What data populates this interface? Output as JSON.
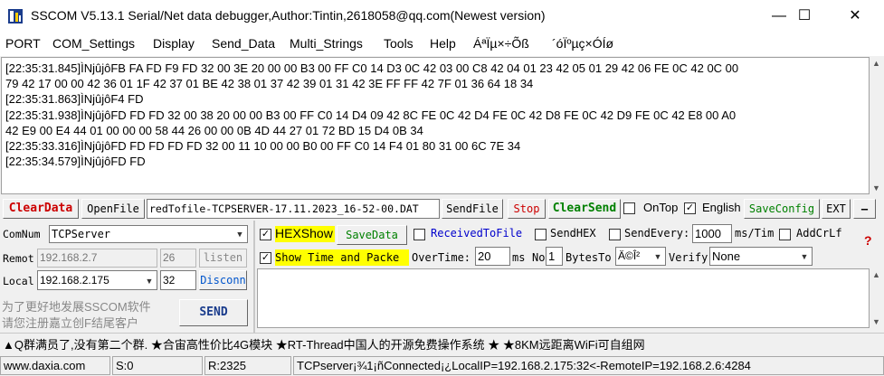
{
  "titlebar": {
    "title": "SSCOM V5.13.1 Serial/Net data debugger,Author:Tintin,2618058@qq.com(Newest version)",
    "minimize": "—",
    "maximize": "☐",
    "close": "✕"
  },
  "menu": {
    "items": [
      "PORT",
      "COM_Settings",
      "Display",
      "Send_Data",
      "Multi_Strings",
      "Tools",
      "Help",
      "ÁªÏµ×÷Õß",
      "´óÏºµç×ÓÍø"
    ]
  },
  "log": {
    "lines": [
      "[22:35:31.845]ÌNjûjôFB FA FD F9 FD 32 00 3E 20 00 00 B3 00 FF C0 14 D3 0C 42 03 00 C8 42 04 01 23 42 05 01 29 42 06 FE 0C 42 0C 00",
      "79 42 17 00 00 42 36 01 1F 42 37 01 BE 42 38 01 37 42 39 01 31 42 3E FF FF 42 7F 01 36 64 18 34",
      "[22:35:31.863]ÌNjûjôF4 FD",
      "[22:35:31.938]ÌNjûjôFD FD FD 32 00 38 20 00 00 B3 00 FF C0 14 D4 09 42 8C FE 0C 42 D4 FE 0C 42 D8 FE 0C 42 D9 FE 0C 42 E8 00 A0",
      "42 E9 00 E4 44 01 00 00 00 58 44 26 00 00 0B 4D 44 27 01 72 BD 15 D4 0B 34",
      "[22:35:33.316]ÌNjûjôFD FD FD FD FD 32 00 11 10 00 00 B0 00 FF C0 14 F4 01 80 31 00 6C 7E 34",
      "[22:35:34.579]ÌNjûjôFD FD"
    ]
  },
  "toolbar": {
    "clear_data": "ClearData",
    "open_file": "OpenFile",
    "file_path": "redTofile-TCPSERVER-17.11.2023_16-52-00.DAT",
    "send_file": "SendFile",
    "stop": "Stop",
    "clear_send": "ClearSend",
    "on_top": "OnTop",
    "english": "English",
    "save_config": "SaveConfig",
    "ext": "EXT",
    "collapse": "—"
  },
  "conn": {
    "comnum_label": "ComNum",
    "comnum_value": "TCPServer",
    "remote_label": "Remot",
    "remote_ip": "192.168.2.7",
    "remote_port": "26",
    "listen": "listen",
    "local_label": "Local",
    "local_ip": "192.168.2.175",
    "local_port": "32",
    "disconnect": "Disconn",
    "ad_text_1": "为了更好地发展SSCOM软件",
    "ad_text_2": "请您注册嘉立创F结尾客户",
    "send": "SEND"
  },
  "options": {
    "hex_show": "HEXShow",
    "save_data": "SaveData",
    "received_to_file": "ReceivedToFile",
    "send_hex": "SendHEX",
    "send_every": "SendEvery:",
    "send_every_value": "1000",
    "ms_tim": "ms/Tim",
    "add_crlf": "AddCrLf",
    "show_time": "Show Time and Packe",
    "overtime_label": "OverTime:",
    "overtime_value": "20",
    "ms": "ms",
    "no_label": "No",
    "no_value": "1",
    "bytes_to": "BytesTo",
    "bytes_to_value": "Ä©Î²",
    "verify_label": "Verify",
    "verify_value": "None",
    "help_mark": "?"
  },
  "marquee": {
    "text": "▲Q群满员了,没有第二个群. ★合宙高性价比4G模块 ★RT-Thread中国人的开源免费操作系统 ★ ★8KM远距离WiFi可自组网"
  },
  "status": {
    "website": "www.daxia.com",
    "sent": "S:0",
    "received": "R:2325",
    "connection": "TCPserver¡¾1¡ñConnected¡¿LocalIP=192.168.2.175:32<-RemoteIP=192.168.2.6:4284"
  },
  "colors": {
    "clear_red": "#cc0000",
    "green_text": "#008000",
    "blue_text": "#0000cc",
    "highlight_yellow": "#ffff00"
  }
}
